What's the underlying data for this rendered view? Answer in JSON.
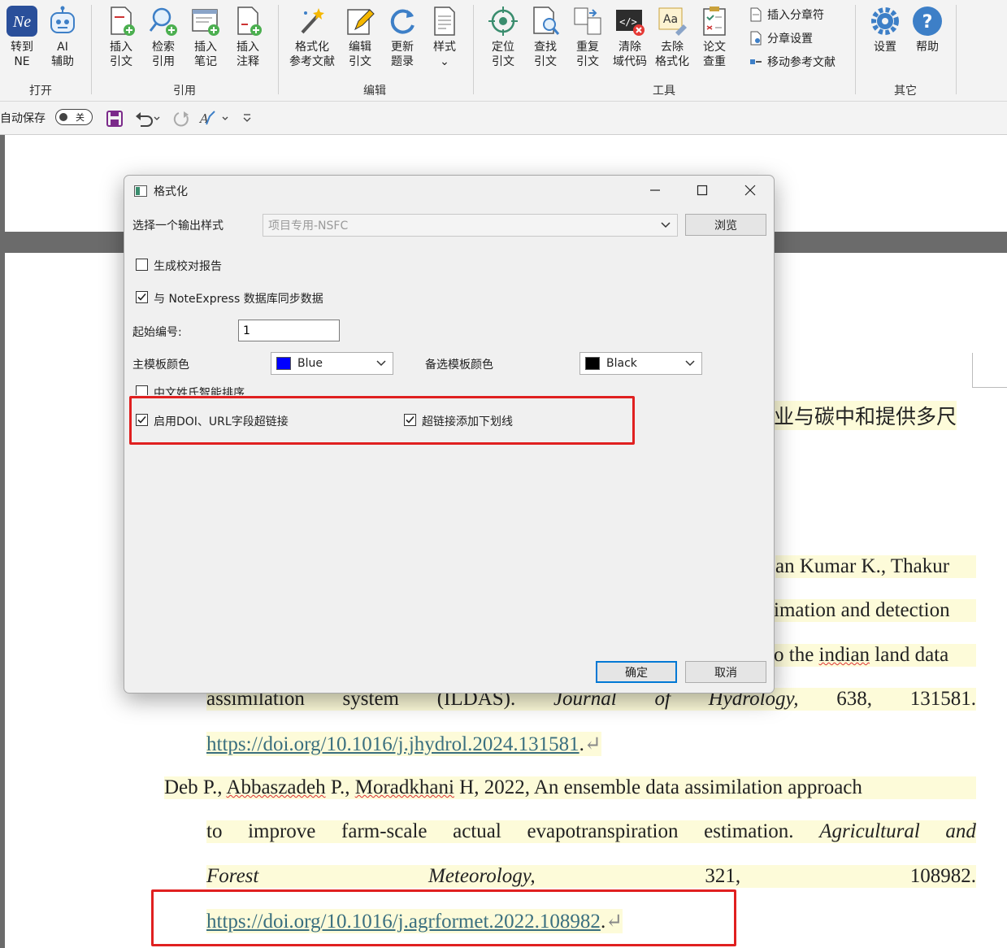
{
  "ribbon": {
    "buttons": [
      {
        "id": "goto-ne",
        "label": "转到\nNE"
      },
      {
        "id": "ai-assist",
        "label": "AI\n辅助"
      },
      {
        "id": "insert-cite",
        "label": "插入\n引文"
      },
      {
        "id": "search-cite",
        "label": "检索\n引用"
      },
      {
        "id": "insert-note",
        "label": "插入\n笔记"
      },
      {
        "id": "insert-annot",
        "label": "插入\n注释"
      },
      {
        "id": "format-ref",
        "label": "格式化\n参考文献"
      },
      {
        "id": "edit-cite",
        "label": "编辑\n引文"
      },
      {
        "id": "update-biblio",
        "label": "更新\n题录"
      },
      {
        "id": "style",
        "label": "样式\n⌄"
      },
      {
        "id": "locate-cite",
        "label": "定位\n引文"
      },
      {
        "id": "find-cite",
        "label": "查找\n引文"
      },
      {
        "id": "dup-cite",
        "label": "重复\n引文"
      },
      {
        "id": "clear-code",
        "label": "清除\n域代码"
      },
      {
        "id": "remove-format",
        "label": "去除\n格式化"
      },
      {
        "id": "paper-check",
        "label": "论文\n查重"
      },
      {
        "id": "settings",
        "label": "设置"
      },
      {
        "id": "help",
        "label": "帮助"
      }
    ],
    "small_buttons": [
      "插入分章符",
      "分章设置",
      "移动参考文献"
    ],
    "groups": [
      "打开",
      "引用",
      "编辑",
      "工具",
      "其它"
    ]
  },
  "qat": {
    "autosave_label": "自动保存",
    "toggle_state": "关"
  },
  "dialog": {
    "title": "格式化",
    "output_style_label": "选择一个输出样式",
    "output_style_value": "项目专用-NSFC",
    "browse_label": "浏览",
    "gen_report_label": "生成校对报告",
    "gen_report_checked": false,
    "sync_label": "与 NoteExpress 数据库同步数据",
    "sync_checked": true,
    "start_number_label": "起始编号:",
    "start_number_value": "1",
    "primary_color_label": "主模板颜色",
    "primary_color_value": "Blue",
    "primary_color_hex": "#0000ff",
    "alt_color_label": "备选模板颜色",
    "alt_color_value": "Black",
    "alt_color_hex": "#000000",
    "cn_sort_label": "中文姓氏智能排序",
    "cn_sort_checked": false,
    "doi_link_label": "启用DOI、URL字段超链接",
    "doi_link_checked": true,
    "underline_label": "超链接添加下划线",
    "underline_checked": true,
    "ok_label": "确定",
    "cancel_label": "取消"
  },
  "document": {
    "frag1": "业与碳中和提供多尺",
    "frag2": "an Kumar K., Thakur",
    "frag3": "imation and detection",
    "frag4_a": "o the ",
    "frag4_b": "indian",
    "frag4_c": " land data",
    "ref1_line4": [
      "assimilation",
      "system",
      "(ILDAS).",
      "Journal",
      "of",
      "Hydrology,",
      "638,",
      "131581."
    ],
    "ref1_url": "https://doi.org/10.1016/j.jhydrol.2024.131581",
    "ref2_author_a": "Deb P., ",
    "ref2_author_b": "Abbaszadeh",
    "ref2_author_c": " P., ",
    "ref2_author_d": "Moradkhani",
    "ref2_author_e": " H, 2022, An ensemble data assimilation approach",
    "ref2_line2": [
      "to",
      "improve",
      "farm-scale",
      "actual",
      "evapotranspiration",
      "estimation.",
      "Agricultural",
      "and"
    ],
    "ref2_line3": [
      "Forest",
      "Meteorology,",
      "321,",
      "108982."
    ],
    "ref2_url": "https://doi.org/10.1016/j.agrformet.2022.108982"
  }
}
